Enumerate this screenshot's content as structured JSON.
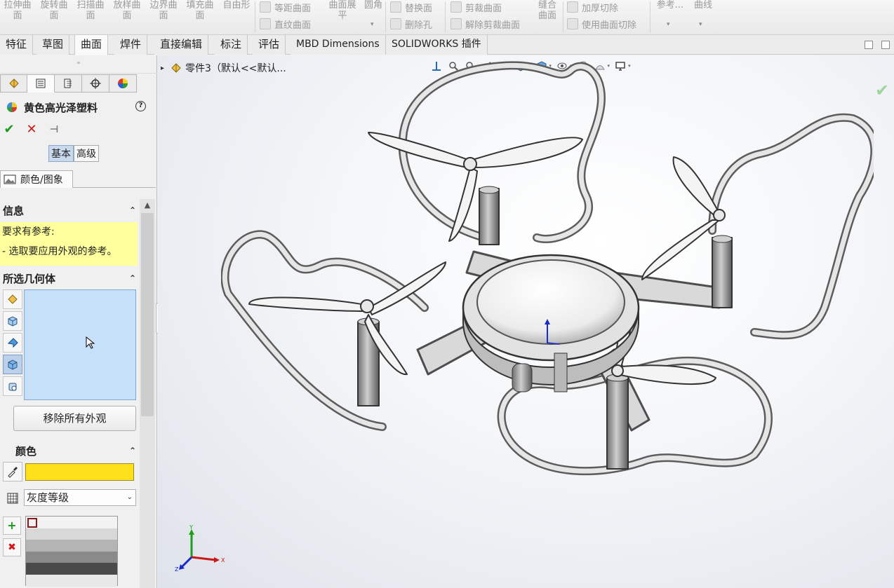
{
  "ribbon": {
    "big_buttons": [
      {
        "l1": "拉伸曲",
        "l2": "面"
      },
      {
        "l1": "旋转曲",
        "l2": "面"
      },
      {
        "l1": "扫描曲",
        "l2": "面"
      },
      {
        "l1": "放样曲",
        "l2": "面"
      },
      {
        "l1": "边界曲",
        "l2": "面"
      },
      {
        "l1": "填充曲",
        "l2": "面"
      },
      {
        "l1": "自由形",
        "l2": ""
      }
    ],
    "offset_surface": "等距曲面",
    "ruled_surface": "直纹曲面",
    "flatten_surface": {
      "l1": "曲面展",
      "l2": "平"
    },
    "fillet": "圆角",
    "replace_face": "替换面",
    "delete_hole": "删除孔",
    "trim_surface": "剪裁曲面",
    "untrim_surface": "解除剪裁曲面",
    "knit_surface": {
      "l1": "缝合",
      "l2": "曲面"
    },
    "thicken_cut": "加厚切除",
    "surface_cut": "使用曲面切除",
    "reference": "参考...",
    "curves": "曲线"
  },
  "tabs": [
    {
      "label": "特征"
    },
    {
      "label": "草图"
    },
    {
      "label": "曲面"
    },
    {
      "label": "焊件"
    },
    {
      "label": "直接编辑"
    },
    {
      "label": "标注"
    },
    {
      "label": "评估"
    },
    {
      "label": "MBD Dimensions"
    },
    {
      "label": "SOLIDWORKS 插件"
    }
  ],
  "property_manager": {
    "title": "黄色高光泽塑料",
    "help": "?",
    "mode_basic": "基本",
    "mode_advanced": "高级",
    "section_tab": "颜色/图象",
    "info_header": "信息",
    "info_line1": "要求有参考:",
    "info_line2": "- 选取要应用外观的参考。",
    "geometry_header": "所选几何体",
    "remove_button": "移除所有外观",
    "color_header": "颜色",
    "color_value": "#ffe01a",
    "palette_value": "灰度等级"
  },
  "viewport": {
    "tree_root": "零件3（默认<<默认..."
  },
  "triad": {
    "x": "X",
    "y": "Y",
    "z": "Z"
  },
  "colors": {
    "accent": "#2a7de1",
    "selection": "#c7e0fa",
    "info": "#ffff9e"
  }
}
